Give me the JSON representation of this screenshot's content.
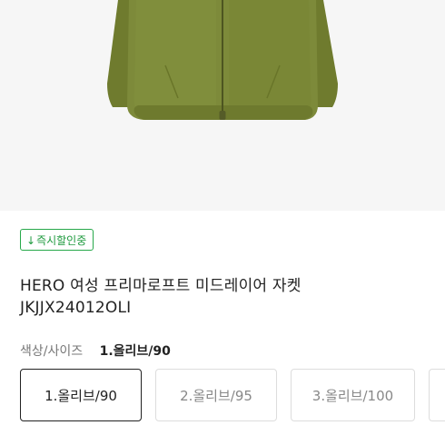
{
  "product": {
    "badge": {
      "arrow": "↓",
      "label": "즉시할인중",
      "color": "#1e9a3e"
    },
    "title_line1": "HERO 여성 프리마로프트 미드레이어 자켓",
    "title_line2": "JKJJX24012OLI",
    "image": {
      "icon": "olive-jacket-image",
      "color": "#7d8a3a"
    }
  },
  "options": {
    "label": "색상/사이즈",
    "selected_value": "1.올리브/90",
    "items": [
      {
        "label": "1.올리브/90",
        "selected": true
      },
      {
        "label": "2.올리브/95",
        "selected": false
      },
      {
        "label": "3.올리브/100",
        "selected": false
      },
      {
        "label": "",
        "selected": false
      }
    ]
  }
}
